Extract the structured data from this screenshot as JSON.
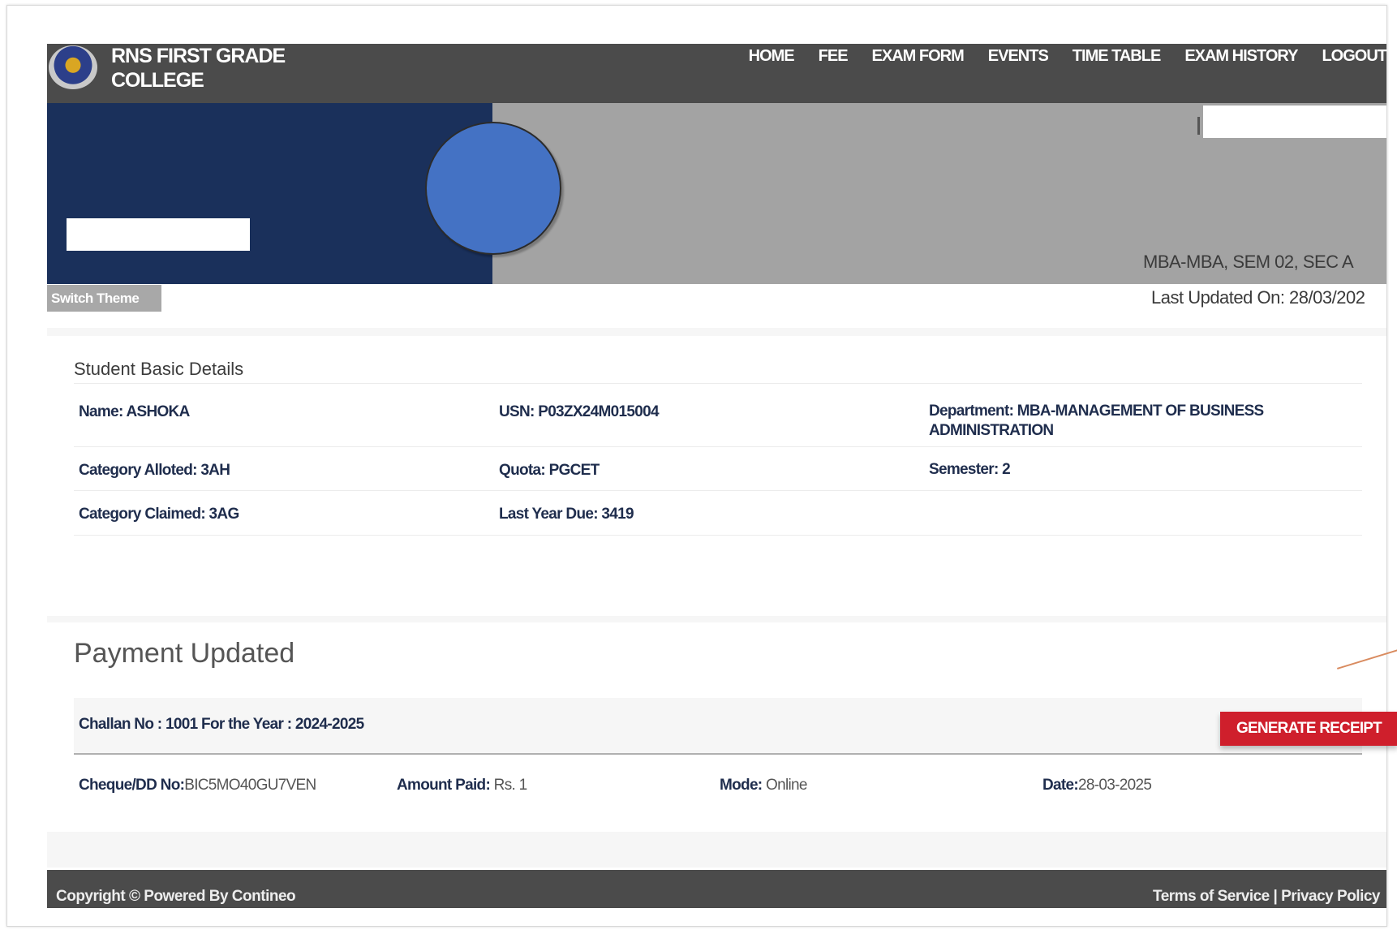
{
  "header": {
    "college_name_line1": "RNS FIRST GRADE",
    "college_name_line2": "COLLEGE",
    "nav": [
      "HOME",
      "FEE",
      "EXAM FORM",
      "EVENTS",
      "TIME TABLE",
      "EXAM HISTORY",
      "LOGOUT"
    ]
  },
  "banner": {
    "course_info": "MBA-MBA, SEM 02, SEC A",
    "last_updated": "Last Updated On: 28/03/202",
    "switch_theme": "Switch Theme"
  },
  "student": {
    "section_title": "Student Basic Details",
    "name": "Name: ASHOKA",
    "usn": "USN: P03ZX24M015004",
    "department": "Department: MBA-MANAGEMENT OF BUSINESS ADMINISTRATION",
    "category_alloted": "Category Alloted: 3AH",
    "quota": "Quota: PGCET",
    "semester": "Semester: 2",
    "category_claimed": "Category Claimed: 3AG",
    "last_year_due": "Last Year Due: 3419"
  },
  "payment": {
    "title": "Payment Updated",
    "challan": "Challan No : 1001 For the Year : 2024-2025",
    "generate_receipt": "GENERATE RECEIPT",
    "cheque_label": "Cheque/DD No:",
    "cheque_value": "BIC5MO40GU7VEN",
    "amount_label": "Amount Paid:",
    "amount_value": " Rs. 1",
    "mode_label": "Mode:",
    "mode_value": " Online",
    "date_label": "Date:",
    "date_value": "28-03-2025"
  },
  "footer": {
    "copyright": "Copyright © Powered By Contineo",
    "terms": "Terms of Service",
    "separator": " | ",
    "privacy": "Privacy Policy"
  }
}
